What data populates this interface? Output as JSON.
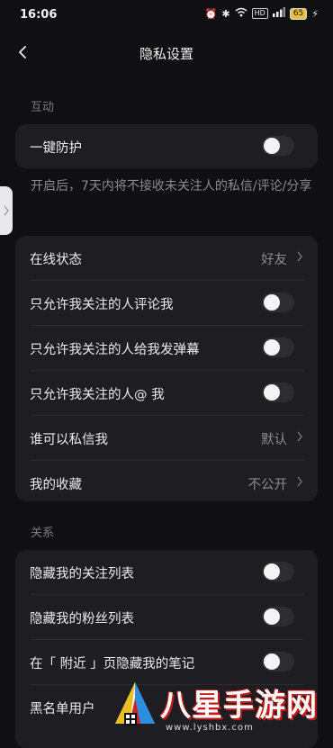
{
  "status_bar": {
    "time": "16:06",
    "network_badge": "HD",
    "battery": "65"
  },
  "header": {
    "title": "隐私设置"
  },
  "interaction": {
    "section_label": "互动",
    "one_key_protect": {
      "label": "一键防护",
      "enabled": false
    },
    "description": "开启后，7天内将不接收未关注人的私信/评论/分享"
  },
  "settings": {
    "online_status": {
      "label": "在线状态",
      "value": "好友"
    },
    "comment_only_following": {
      "label": "只允许我关注的人评论我",
      "enabled": false
    },
    "danmaku_only_following": {
      "label": "只允许我关注的人给我发弹幕",
      "enabled": false
    },
    "mention_only_following": {
      "label": "只允许我关注的人@ 我",
      "enabled": false
    },
    "who_can_dm": {
      "label": "谁可以私信我",
      "value": "默认"
    },
    "my_favorites": {
      "label": "我的收藏",
      "value": "不公开"
    }
  },
  "relations": {
    "section_label": "关系",
    "hide_following": {
      "label": "隐藏我的关注列表",
      "enabled": false
    },
    "hide_fans": {
      "label": "隐藏我的粉丝列表",
      "enabled": false
    },
    "hide_notes_nearby": {
      "label": "在「 附近 」页隐藏我的笔记",
      "enabled": false
    },
    "blacklist": {
      "label": "黑名单用户"
    }
  },
  "watermark": {
    "text": "八星手游网",
    "url": "www.lyshbx.com"
  }
}
